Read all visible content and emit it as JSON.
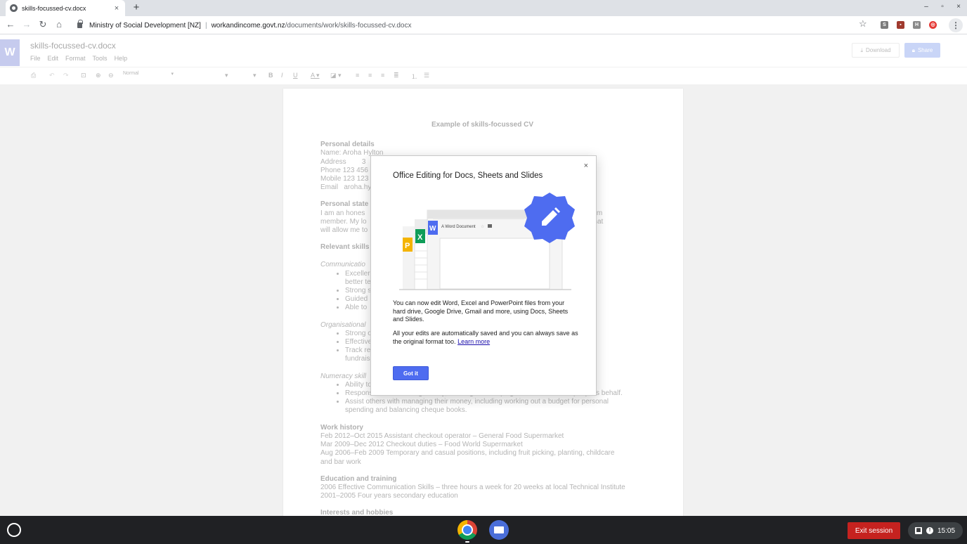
{
  "browser": {
    "tab_title": "skills-focussed-cv.docx",
    "tab_close": "×",
    "new_tab": "+",
    "window_controls": [
      "–",
      "▫",
      "×"
    ],
    "org_name": "Ministry of Social Development [NZ]",
    "separator": "|",
    "url_host": "workandincome.govt.nz",
    "url_path": "/documents/work/skills-focussed-cv.docx",
    "extensions": [
      {
        "label": "S",
        "color": "#7b7b7b"
      },
      {
        "label": "▪",
        "color": "#a03a2e"
      },
      {
        "label": "H",
        "color": "#8a8a8a"
      },
      {
        "label": "◎",
        "color": "#e53935"
      }
    ]
  },
  "docs": {
    "logo": "W",
    "doc_name": "skills-focussed-cv.docx",
    "menu": [
      "File",
      "Edit",
      "Format",
      "Tools",
      "Help"
    ],
    "download_label": "Download",
    "share_label": "Share",
    "style_value": "Normal"
  },
  "document": {
    "title": "Example of skills-focussed CV",
    "personal_details_heading": "Personal details",
    "details": [
      "Name: Aroha Hylton",
      "Address        3",
      "Phone 123 456",
      "Mobile 123 123",
      "Email   aroha.hy"
    ],
    "statement_heading": "Personal state",
    "statement_lines": [
      "I am an hones                                                                                                   a helpful team",
      "member. My lo                                                                                                 g for a role that",
      "will allow me to"
    ],
    "skills_heading": "Relevant skills",
    "communication_heading": "Communicatio",
    "communication_items": [
      "Exceller                                                                                      st",
      "Strong s                                                                                         k situations.",
      "Guided",
      "Able to"
    ],
    "communication_cont": "better te",
    "organisational_heading": "Organisational",
    "organisational_items": [
      "Strong o",
      "Effective",
      "Track re                                                                                           work and"
    ],
    "organisational_cont": "fundrais",
    "numeracy_heading": "Numeracy skill",
    "numeracy_items": [
      "Ability to                                                                                                 asurer.",
      "Responsible for handling money, banking and keeping accounts on other people's behalf.",
      "Assist others with managing their money, including working out a budget for personal"
    ],
    "numeracy_cont": "spending and balancing cheque books.",
    "work_heading": "Work history",
    "work_lines": [
      "Feb 2012–Oct 2015 Assistant checkout operator – General Food Supermarket",
      "Mar 2009–Dec 2012 Checkout duties – Food World Supermarket",
      "Aug 2006–Feb 2009 Temporary and casual positions, including fruit picking, planting, childcare",
      "and bar work"
    ],
    "education_heading": "Education and training",
    "education_lines": [
      "2006 Effective Communication Skills – three hours a week for 20 weeks at local Technical Institute",
      "2001–2005 Four years secondary education"
    ],
    "interests_heading": "Interests and hobbies"
  },
  "modal": {
    "close": "×",
    "title": "Office Editing for Docs, Sheets and Slides",
    "illus_doc_title": "A Word Document",
    "illus_w": "W",
    "illus_x": "X",
    "illus_p": "P",
    "paragraph1": "You can now edit Word, Excel and PowerPoint files from your hard drive, Google Drive, Gmail and more, using Docs, Sheets and Slides.",
    "paragraph2": "All your edits are automatically saved and you can always save as the original format too.",
    "learn_more": "Learn more",
    "button": "Got it"
  },
  "shelf": {
    "exit_label": "Exit session",
    "clock": "15:05"
  }
}
